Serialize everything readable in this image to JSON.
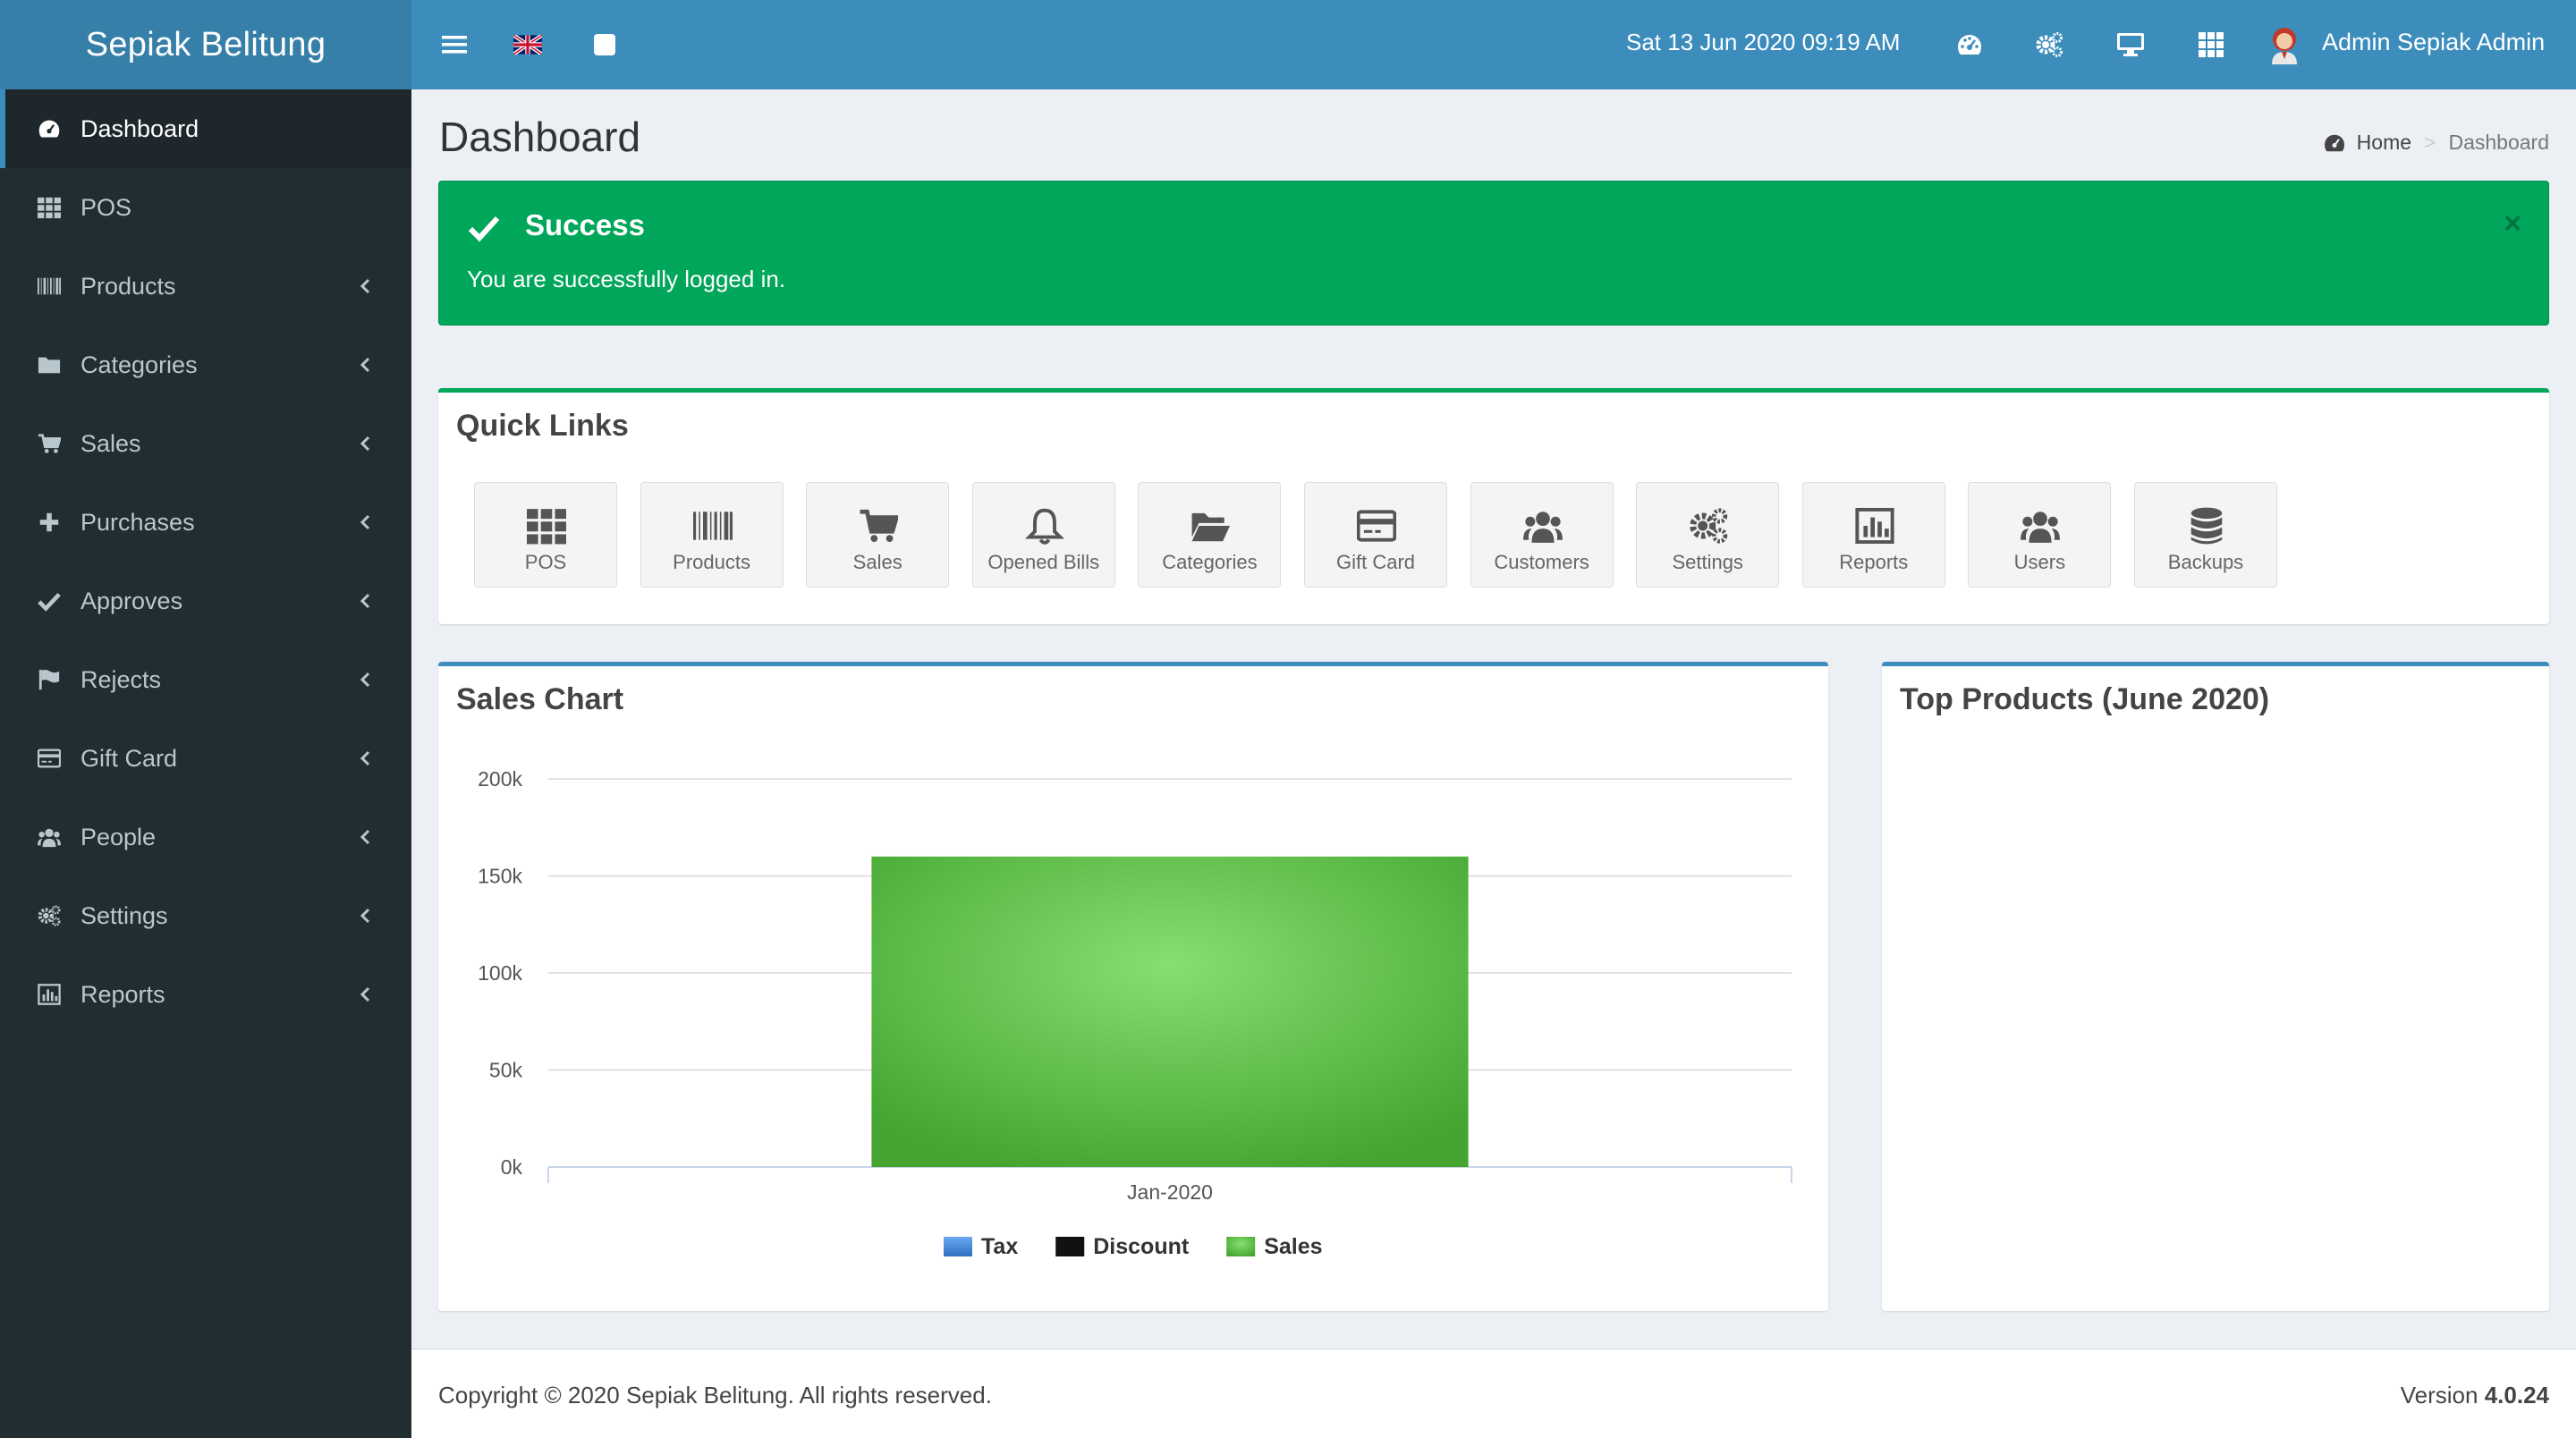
{
  "app": {
    "brand": "Sepiak Belitung"
  },
  "header": {
    "datetime": "Sat 13 Jun 2020 09:19 AM",
    "user_name": "Admin Sepiak Admin",
    "icons": [
      "menu-toggle-icon",
      "uk-flag-icon",
      "square-icon",
      "dashboard-icon",
      "settings-gears-icon",
      "monitor-icon",
      "grid-icon"
    ]
  },
  "sidebar": {
    "items": [
      {
        "label": "Dashboard",
        "icon": "dashboard-icon",
        "active": true,
        "has_children": false
      },
      {
        "label": "POS",
        "icon": "grid-icon",
        "active": false,
        "has_children": false
      },
      {
        "label": "Products",
        "icon": "barcode-icon",
        "active": false,
        "has_children": true
      },
      {
        "label": "Categories",
        "icon": "folder-icon",
        "active": false,
        "has_children": true
      },
      {
        "label": "Sales",
        "icon": "cart-icon",
        "active": false,
        "has_children": true
      },
      {
        "label": "Purchases",
        "icon": "plus-icon",
        "active": false,
        "has_children": true
      },
      {
        "label": "Approves",
        "icon": "check-icon",
        "active": false,
        "has_children": true
      },
      {
        "label": "Rejects",
        "icon": "flag-icon",
        "active": false,
        "has_children": true
      },
      {
        "label": "Gift Card",
        "icon": "credit-card-icon",
        "active": false,
        "has_children": true
      },
      {
        "label": "People",
        "icon": "users-icon",
        "active": false,
        "has_children": true
      },
      {
        "label": "Settings",
        "icon": "gears-icon",
        "active": false,
        "has_children": true
      },
      {
        "label": "Reports",
        "icon": "bar-chart-icon",
        "active": false,
        "has_children": true
      }
    ]
  },
  "content": {
    "title": "Dashboard",
    "breadcrumb": {
      "home": "Home",
      "current": "Dashboard"
    }
  },
  "alert": {
    "title": "Success",
    "message": "You are successfully logged in.",
    "close": "×",
    "color": "#00a65a"
  },
  "quick_links": {
    "title": "Quick Links",
    "items": [
      {
        "label": "POS",
        "icon": "grid-icon"
      },
      {
        "label": "Products",
        "icon": "barcode-icon"
      },
      {
        "label": "Sales",
        "icon": "cart-icon"
      },
      {
        "label": "Opened Bills",
        "icon": "bell-icon"
      },
      {
        "label": "Categories",
        "icon": "folder-open-icon"
      },
      {
        "label": "Gift Card",
        "icon": "credit-card-icon"
      },
      {
        "label": "Customers",
        "icon": "users-icon"
      },
      {
        "label": "Settings",
        "icon": "gears-icon"
      },
      {
        "label": "Reports",
        "icon": "bar-chart-icon"
      },
      {
        "label": "Users",
        "icon": "users-icon"
      },
      {
        "label": "Backups",
        "icon": "database-icon"
      }
    ]
  },
  "sales_chart": {
    "title": "Sales Chart"
  },
  "chart_data": {
    "type": "bar",
    "categories": [
      "Jan-2020"
    ],
    "series": [
      {
        "name": "Tax",
        "values": [
          0
        ],
        "color": "#3c7fd0"
      },
      {
        "name": "Discount",
        "values": [
          0
        ],
        "color": "#111111"
      },
      {
        "name": "Sales",
        "values": [
          160000
        ],
        "color": "#4cb84a"
      }
    ],
    "y_ticks": [
      "0k",
      "50k",
      "100k",
      "150k",
      "200k"
    ],
    "ylim": [
      0,
      200000
    ],
    "grid": true,
    "legend": "bottom-center"
  },
  "top_products": {
    "title": "Top Products (June 2020)"
  },
  "footer": {
    "copyright": "Copyright © 2020 Sepiak Belitung. All rights reserved.",
    "version_label": "Version",
    "version": "4.0.24"
  }
}
